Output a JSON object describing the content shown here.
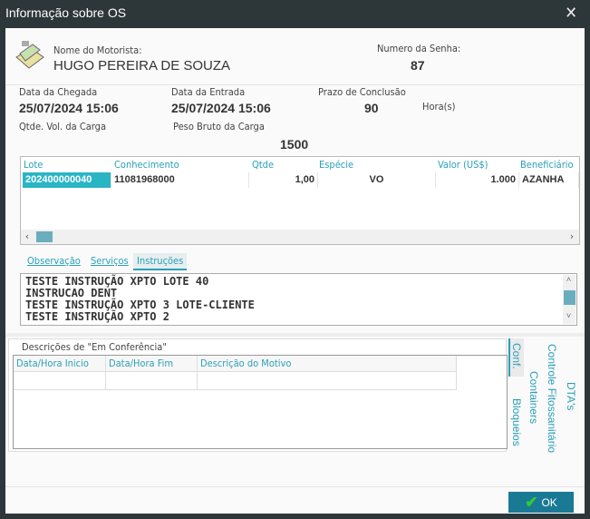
{
  "window": {
    "title": "Informação sobre OS",
    "close": "✕"
  },
  "driver": {
    "label": "Nome do Motorista:",
    "value": "HUGO PEREIRA DE SOUZA"
  },
  "senha": {
    "label": "Numero da Senha:",
    "value": "87"
  },
  "chegada": {
    "label": "Data da Chegada",
    "value": "25/07/2024 15:06"
  },
  "entrada": {
    "label": "Data da Entrada",
    "value": "25/07/2024 15:06"
  },
  "prazo": {
    "label": "Prazo de Conclusão",
    "value": "90",
    "unit": "Hora(s)"
  },
  "qtde_vol": {
    "label": "Qtde. Vol. da Carga"
  },
  "peso": {
    "label": "Peso Bruto da Carga",
    "value": "1500"
  },
  "grid": {
    "headers": [
      "Lote",
      "Conhecimento",
      "Qtde",
      "Espécie",
      "Valor (US$)",
      "Beneficiário"
    ],
    "rows": [
      [
        "202400000040",
        "11081968000",
        "1,00",
        "VO",
        "1.000",
        "AZANHA TR"
      ]
    ]
  },
  "tabs": [
    "Observação",
    "Serviços",
    "Instruções"
  ],
  "instructions": [
    "TESTE INSTRUÇÃO XPTO LOTE 40",
    "INSTRUCAO DENT",
    "TESTE INSTRUÇÃO XPTO 3 LOTE-CLIENTE",
    "TESTE INSTRUÇÃO XPTO 2"
  ],
  "conf": {
    "group_label": "Descrições de \"Em Conferência\"",
    "headers": [
      "Data/Hora Inicio",
      "Data/Hora Fim",
      "Descrição do Motivo"
    ]
  },
  "side_tabs": [
    "Conf.",
    "Bloqueios",
    "Containers",
    "Controle Fitossanitário",
    "DTA's"
  ],
  "ok_label": "OK",
  "accent": "#2aa0b8"
}
